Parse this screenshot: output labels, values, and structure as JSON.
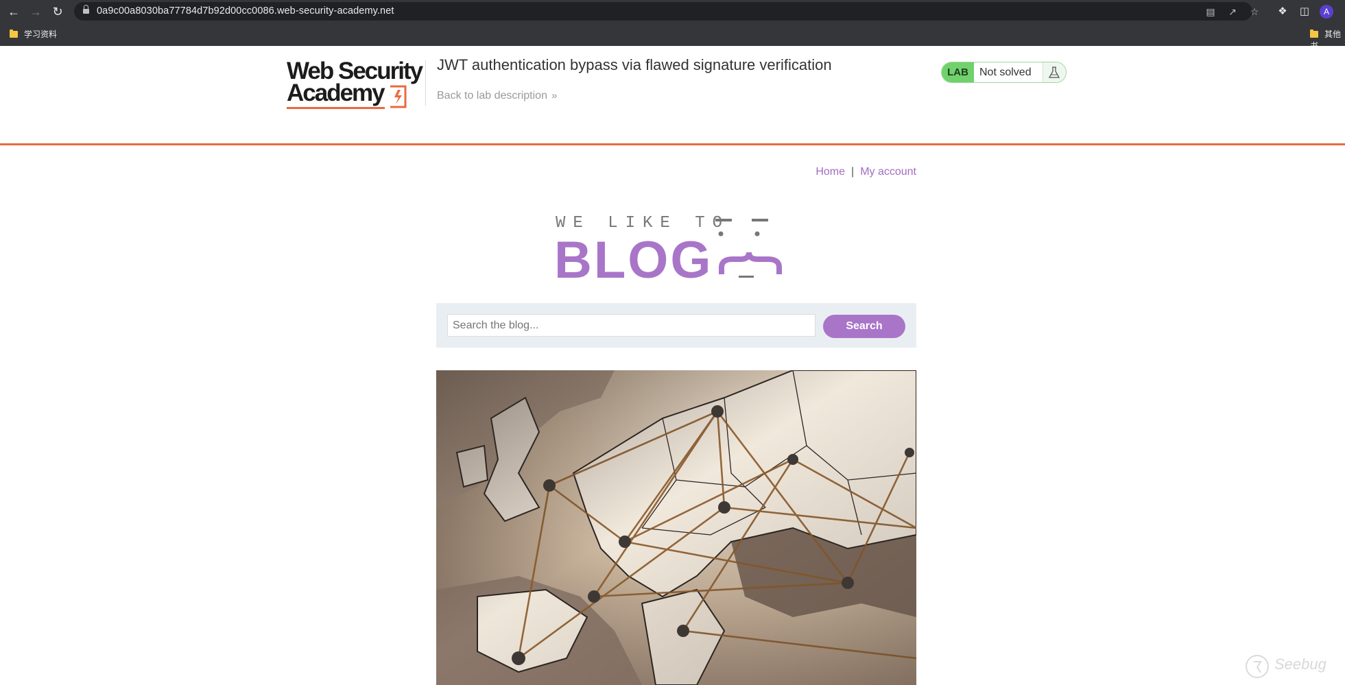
{
  "browser": {
    "url": "0a9c00a8030ba77784d7b92d00cc0086.web-security-academy.net",
    "profile_initial": "A",
    "bookmarks": [
      {
        "label": "学习资料"
      },
      {
        "label": "其他书"
      }
    ]
  },
  "lab_header": {
    "logo_line1": "Web Security",
    "logo_line2": "Academy",
    "title": "JWT authentication bypass via flawed signature verification",
    "back_link": "Back to lab description",
    "back_chevron": "»",
    "status_badge": "LAB",
    "status_text": "Not solved",
    "accent_color": "#ea6a3d",
    "badge_color": "#70d16d"
  },
  "blog": {
    "nav": {
      "home": "Home",
      "separator": "|",
      "account": "My account"
    },
    "logo_top": "WE LIKE TO",
    "logo_main": "BLOG",
    "search": {
      "placeholder": "Search the blog...",
      "button": "Search"
    },
    "accent_color": "#a875c8"
  },
  "watermark": {
    "text": "Seebug"
  }
}
